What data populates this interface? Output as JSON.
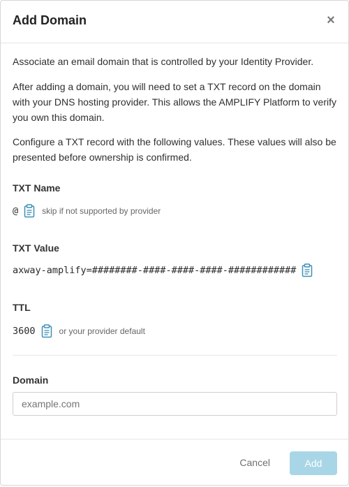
{
  "dialog": {
    "title": "Add Domain",
    "close_glyph": "×"
  },
  "description": {
    "p1": "Associate an email domain that is controlled by your Identity Provider.",
    "p2": "After adding a domain, you will need to set a TXT record on the domain with your DNS hosting provider. This allows the AMPLIFY Platform to verify you own this domain.",
    "p3": "Configure a TXT record with the following values. These values will also be presented before ownership is confirmed."
  },
  "txt_name": {
    "label": "TXT Name",
    "value": "@",
    "hint": "skip if not supported by provider",
    "icon": "clipboard-icon"
  },
  "txt_value": {
    "label": "TXT Value",
    "value": "axway-amplify=########-####-####-####-############",
    "icon": "clipboard-icon"
  },
  "ttl": {
    "label": "TTL",
    "value": "3600",
    "hint": "or your provider default",
    "icon": "clipboard-icon"
  },
  "domain": {
    "label": "Domain",
    "placeholder": "example.com",
    "value": ""
  },
  "footer": {
    "cancel_label": "Cancel",
    "add_label": "Add"
  },
  "colors": {
    "accent": "#3f8fb5",
    "add_button_disabled": "#a9d6e7"
  }
}
